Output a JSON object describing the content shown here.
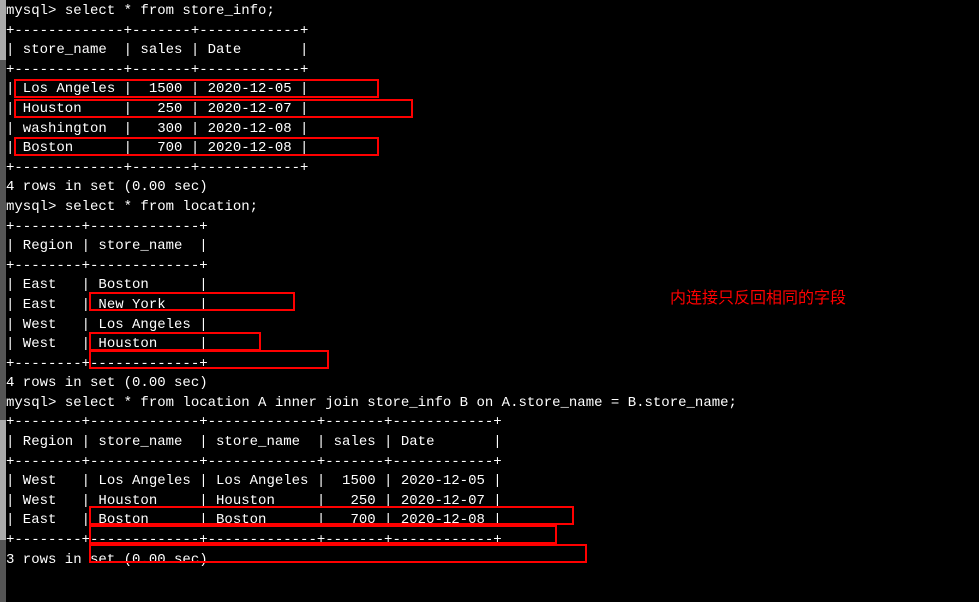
{
  "query1": {
    "prompt": "mysql> ",
    "sql": "select * from store_info;",
    "border_top": "+-------------+-------+------------+",
    "border_mid": "+-------------+-------+------------+",
    "border_bot": "+-------------+-------+------------+",
    "header": "| store_name  | sales | Date       |",
    "rows": [
      "| Los Angeles |  1500 | 2020-12-05 |",
      "| Houston     |   250 | 2020-12-07 |",
      "| washington  |   300 | 2020-12-08 |",
      "| Boston      |   700 | 2020-12-08 |"
    ],
    "footer": "4 rows in set (0.00 sec)"
  },
  "query2": {
    "prompt": "mysql> ",
    "sql": "select * from location;",
    "border_top": "+--------+-------------+",
    "border_mid": "+--------+-------------+",
    "border_bot": "+--------+-------------+",
    "header": "| Region | store_name  |",
    "rows": [
      "| East   | Boston      |",
      "| East   | New York    |",
      "| West   | Los Angeles |",
      "| West   | Houston     |"
    ],
    "footer": "4 rows in set (0.00 sec)"
  },
  "query3": {
    "prompt": "mysql> ",
    "sql": "select * from location A inner join store_info B on A.store_name = B.store_name;",
    "border_top": "+--------+-------------+-------------+-------+------------+",
    "border_mid": "+--------+-------------+-------------+-------+------------+",
    "border_bot": "+--------+-------------+-------------+-------+------------+",
    "header": "| Region | store_name  | store_name  | sales | Date       |",
    "rows": [
      "| West   | Los Angeles | Los Angeles |  1500 | 2020-12-05 |",
      "| West   | Houston     | Houston     |   250 | 2020-12-07 |",
      "| East   | Boston      | Boston      |   700 | 2020-12-08 |"
    ],
    "footer": "3 rows in set (0.00 sec)"
  },
  "annotation": "内连接只反回相同的字段",
  "blank": ""
}
